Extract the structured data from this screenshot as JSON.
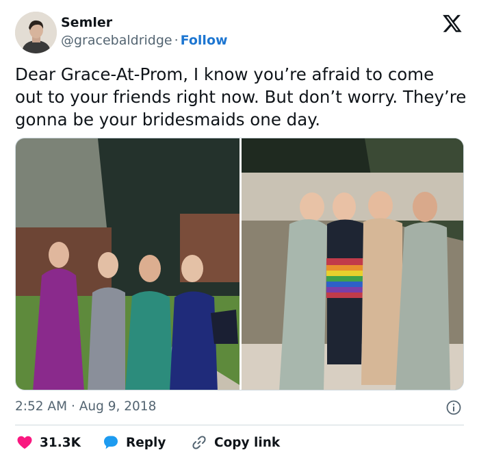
{
  "author": {
    "name": "Semler",
    "handle": "@gracebaldridge",
    "separator": "·",
    "follow_label": "Follow"
  },
  "tweet": {
    "text": "Dear Grace-At-Prom, I know you’re afraid to come out to your friends right now. But don’t worry. They’re gonna be your bridesmaids one day.",
    "time": "2:52 AM",
    "date_separator": "·",
    "date": "Aug 9, 2018"
  },
  "actions": {
    "like_count": "31.3K",
    "reply_label": "Reply",
    "copy_label": "Copy link"
  },
  "icons": {
    "brand": "x-logo-icon",
    "info": "info-icon",
    "like": "heart-icon",
    "reply": "speech-bubble-icon",
    "copy": "link-icon"
  },
  "colors": {
    "follow": "#1d76d1",
    "heart": "#f91880",
    "reply": "#1d9bf0",
    "muted": "#536471",
    "text": "#0f1419"
  }
}
